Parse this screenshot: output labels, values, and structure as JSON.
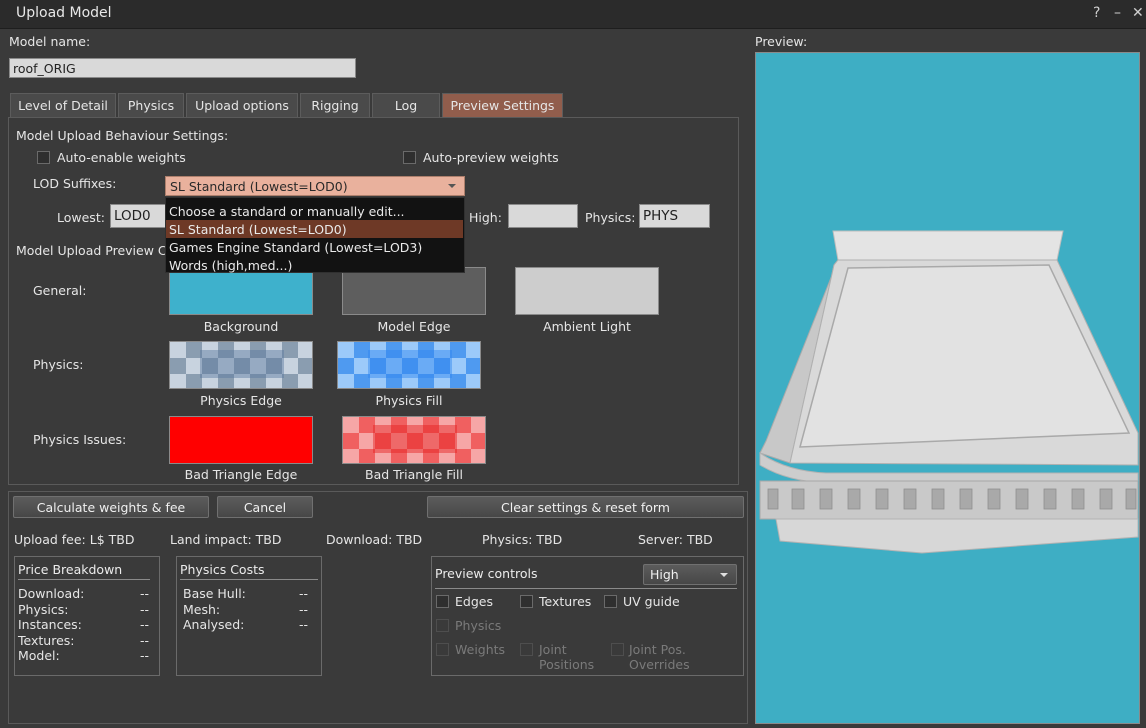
{
  "window": {
    "title": "Upload Model",
    "help_glyph": "?",
    "minimize_glyph": "–",
    "close_glyph": "✕"
  },
  "model_name": {
    "label": "Model name:",
    "value": "roof_ORIG"
  },
  "tabs": [
    {
      "label": "Level of Detail"
    },
    {
      "label": "Physics"
    },
    {
      "label": "Upload options"
    },
    {
      "label": "Rigging"
    },
    {
      "label": "Log"
    },
    {
      "label": "Preview Settings",
      "active": true
    }
  ],
  "behaviour": {
    "heading": "Model Upload Behaviour Settings:",
    "auto_enable_weights": "Auto-enable weights",
    "auto_preview_weights": "Auto-preview weights",
    "lod_suffixes_label": "LOD Suffixes:",
    "lod_selected": "SL Standard (Lowest=LOD0)",
    "dropdown_options": [
      "Choose a standard or manually edit...",
      "SL Standard (Lowest=LOD0)",
      "Games Engine Standard (Lowest=LOD3)",
      "Words (high,med...)"
    ],
    "lowest_label": "Lowest:",
    "lowest_value": "LOD0",
    "high_label": "High:",
    "high_value": "",
    "physics_label": "Physics:",
    "physics_value": "PHYS"
  },
  "preview_colors": {
    "heading": "Model Upload Preview C",
    "general_label": "General:",
    "physics_label": "Physics:",
    "physics_issues_label": "Physics Issues:",
    "swatches": {
      "background": {
        "label": "Background",
        "color": "#3eb1cc"
      },
      "model_edge": {
        "label": "Model Edge",
        "color": "#5e5e5e"
      },
      "ambient_light": {
        "label": "Ambient Light",
        "color": "#cdcdcd"
      },
      "physics_edge": {
        "label": "Physics Edge"
      },
      "physics_fill": {
        "label": "Physics Fill"
      },
      "bad_triangle_edge": {
        "label": "Bad Triangle Edge",
        "color": "#ff0000"
      },
      "bad_triangle_fill": {
        "label": "Bad Triangle Fill"
      }
    }
  },
  "buttons": {
    "calculate": "Calculate weights & fee",
    "cancel": "Cancel",
    "clear_reset": "Clear settings & reset form"
  },
  "fees": {
    "upload_fee": "Upload fee: L$ TBD",
    "land_impact": "Land impact: TBD",
    "download": "Download: TBD",
    "physics": "Physics: TBD",
    "server": "Server: TBD"
  },
  "price_breakdown": {
    "title": "Price Breakdown",
    "rows": [
      {
        "label": "Download:",
        "value": "--"
      },
      {
        "label": "Physics:",
        "value": "--"
      },
      {
        "label": "Instances:",
        "value": "--"
      },
      {
        "label": "Textures:",
        "value": "--"
      },
      {
        "label": "Model:",
        "value": "--"
      }
    ]
  },
  "physics_costs": {
    "title": "Physics Costs",
    "rows": [
      {
        "label": "Base Hull:",
        "value": "--"
      },
      {
        "label": "Mesh:",
        "value": "--"
      },
      {
        "label": "Analysed:",
        "value": "--"
      }
    ]
  },
  "preview_controls": {
    "title": "Preview controls",
    "quality": "High",
    "edges": "Edges",
    "textures": "Textures",
    "uv_guide": "UV guide",
    "physics": "Physics",
    "weights": "Weights",
    "joint_positions_1": "Joint",
    "joint_positions_2": "Positions",
    "joint_overrides_1": "Joint Pos.",
    "joint_overrides_2": "Overrides"
  },
  "preview": {
    "label": "Preview:",
    "background": "#3eaec4"
  }
}
